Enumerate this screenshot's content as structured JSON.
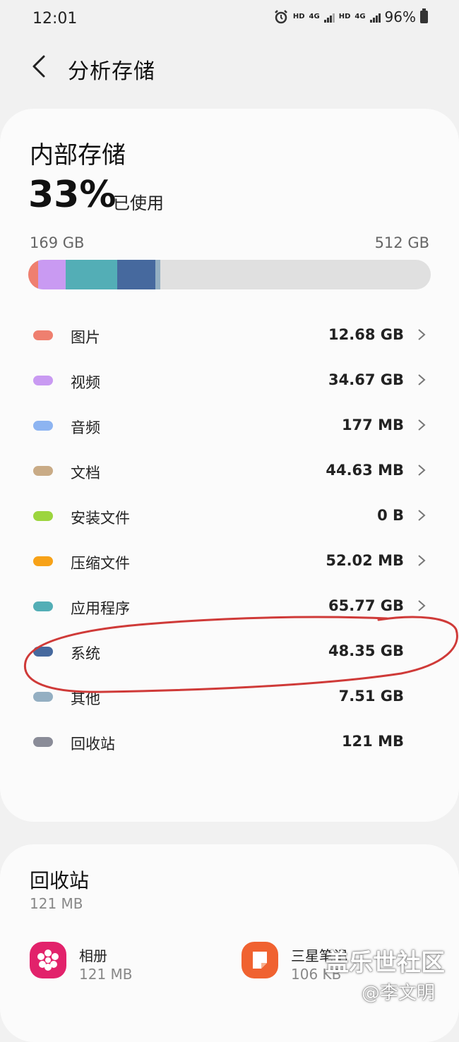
{
  "status_bar": {
    "time": "12:01",
    "hd1": "HD",
    "net1": "4G",
    "hd2": "HD",
    "net2": "4G",
    "battery": "96%"
  },
  "header": {
    "title": "分析存储"
  },
  "storage": {
    "title": "内部存储",
    "percent": "33%",
    "used_label": "已使用",
    "used_size": "169 GB",
    "total_size": "512 GB",
    "used_fraction": 0.33
  },
  "categories": [
    {
      "label": "图片",
      "value": "12.68 GB",
      "color": "#ef7f6f",
      "chevron": true
    },
    {
      "label": "视频",
      "value": "34.67 GB",
      "color": "#c99af2",
      "chevron": true
    },
    {
      "label": "音频",
      "value": "177 MB",
      "color": "#8db4f1",
      "chevron": true
    },
    {
      "label": "文档",
      "value": "44.63 MB",
      "color": "#c9ab86",
      "chevron": true
    },
    {
      "label": "安装文件",
      "value": "0 B",
      "color": "#9cd53e",
      "chevron": true
    },
    {
      "label": "压缩文件",
      "value": "52.02 MB",
      "color": "#f7a218",
      "chevron": true
    },
    {
      "label": "应用程序",
      "value": "65.77 GB",
      "color": "#53aeb6",
      "chevron": true
    },
    {
      "label": "系统",
      "value": "48.35 GB",
      "color": "#46699e",
      "chevron": false
    },
    {
      "label": "其他",
      "value": "7.51 GB",
      "color": "#94afc2",
      "chevron": false
    },
    {
      "label": "回收站",
      "value": "121 MB",
      "color": "#8a8c98",
      "chevron": false
    }
  ],
  "trash": {
    "title": "回收站",
    "size": "121 MB",
    "apps": [
      {
        "name": "相册",
        "size": "121 MB",
        "icon": "flower-icon",
        "color": "#e2226b"
      },
      {
        "name": "三星笔记",
        "size": "106 KB",
        "icon": "notes-icon",
        "color": "#f06230"
      }
    ]
  },
  "watermark": {
    "line1": "盖乐世社区",
    "line2": "@李文明"
  }
}
